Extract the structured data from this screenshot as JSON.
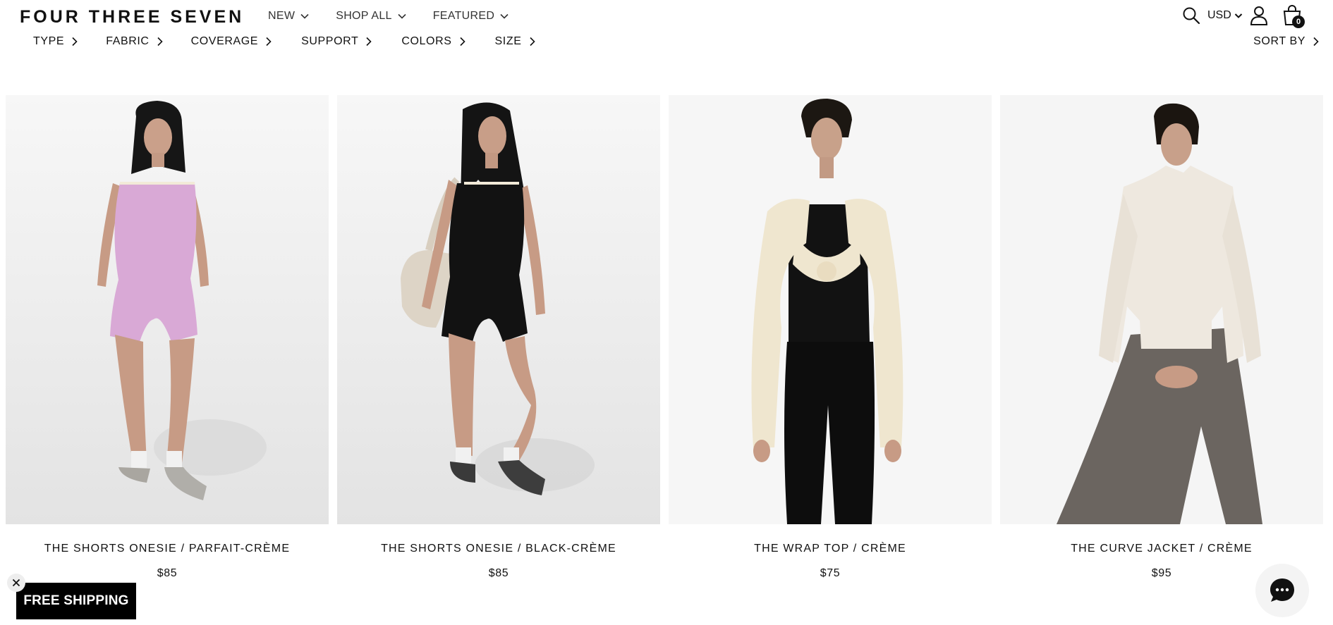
{
  "header": {
    "logo": "FOUR THREE SEVEN",
    "nav": [
      {
        "label": "NEW"
      },
      {
        "label": "SHOP ALL"
      },
      {
        "label": "FEATURED"
      }
    ],
    "currency": "USD",
    "cart_count": "0",
    "icons": [
      "search-icon",
      "chevron-down-icon",
      "account-icon",
      "cart-icon"
    ]
  },
  "filters": [
    {
      "label": "TYPE"
    },
    {
      "label": "FABRIC"
    },
    {
      "label": "COVERAGE"
    },
    {
      "label": "SUPPORT"
    },
    {
      "label": "COLORS"
    },
    {
      "label": "SIZE"
    }
  ],
  "sort_label": "SORT BY",
  "products": [
    {
      "title": "THE SHORTS ONESIE / PARFAIT-CRÈME",
      "price": "$85",
      "color": "#d9a9d6"
    },
    {
      "title": "THE SHORTS ONESIE / BLACK-CRÈME",
      "price": "$85",
      "color": "#121212"
    },
    {
      "title": "THE WRAP TOP / CRÈME",
      "price": "$75",
      "color": "#efe6cf"
    },
    {
      "title": "THE CURVE JACKET / CRÈME",
      "price": "$95",
      "color": "#eee8df"
    }
  ],
  "shipping_banner": "FREE SHIPPING",
  "colors": {
    "text": "#111111",
    "banner": "#000000",
    "photo_bg": "#f3f3f3"
  }
}
